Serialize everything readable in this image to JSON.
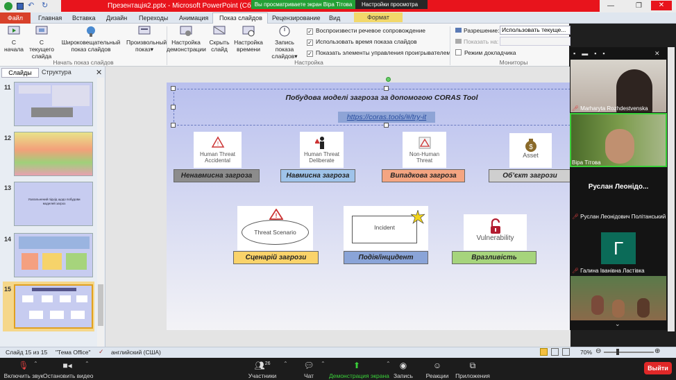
{
  "window": {
    "title": "Презентація2.pptx - Microsoft PowerPoint (Сбой акт",
    "share_banner": "Вы просматриваете экран Віра Тітова",
    "view_settings": "Настройки просмотра",
    "format_tab": "Формат"
  },
  "ribbon_tabs": [
    "Файл",
    "Главная",
    "Вставка",
    "Дизайн",
    "Переходы",
    "Анимация",
    "Показ слайдов",
    "Рецензирование",
    "Вид"
  ],
  "ribbon": {
    "groups": [
      "Начать показ слайдов",
      "Настройка",
      "Мониторы"
    ],
    "buttons": [
      {
        "label": "С начала",
        "icon": "slideshow-start-icon"
      },
      {
        "label": "С текущего слайда",
        "icon": "slideshow-current-icon"
      },
      {
        "label": "Широковещательный показ слайдов",
        "icon": "broadcast-icon"
      },
      {
        "label": "Произвольный показ",
        "icon": "custom-show-icon"
      },
      {
        "label": "Настройка демонстрации",
        "icon": "setup-show-icon"
      },
      {
        "label": "Скрыть слайд",
        "icon": "hide-slide-icon"
      },
      {
        "label": "Настройка времени",
        "icon": "rehearse-timings-icon"
      },
      {
        "label": "Запись показа слайдов",
        "icon": "record-show-icon"
      }
    ],
    "checkboxes": [
      {
        "label": "Воспроизвести речевое сопровождение",
        "checked": true
      },
      {
        "label": "Использовать время показа слайдов",
        "checked": true
      },
      {
        "label": "Показать элементы управления проигрывателем",
        "checked": true
      }
    ],
    "monitors": {
      "resolution_label": "Разрешение:",
      "resolution_value": "Использовать текуще...",
      "show_on_label": "Показать на:",
      "presenter_view": "Режим докладчика"
    }
  },
  "left_panel": {
    "tabs": [
      "Слайды",
      "Структура"
    ],
    "slides": [
      {
        "num": "11",
        "selected": false
      },
      {
        "num": "12",
        "selected": false
      },
      {
        "num": "13",
        "selected": false,
        "text": "Узагальнений підхід щодо побудови моделей загроз"
      },
      {
        "num": "14",
        "selected": false
      },
      {
        "num": "15",
        "selected": true
      }
    ]
  },
  "slide": {
    "title": "Побудова моделі загроза за допомогою CORAS Tool",
    "link": "https://coras.tools/#/try-it",
    "top_cards": [
      {
        "text": "Human Threat Accidental",
        "label": "Ненавмисна загроза",
        "label_color": "#8c8c8c"
      },
      {
        "text": "Human Threat Deliberate",
        "label": "Навмисна загроза",
        "label_color": "#9fc3ea"
      },
      {
        "text": "Non-Human Threat",
        "label": "Випадкова загроза",
        "label_color": "#f4a582"
      },
      {
        "text": "Asset",
        "label": "Об’єкт загрози",
        "label_color": "#cfcfcf"
      }
    ],
    "bottom_cards": [
      {
        "text": "Threat Scenario",
        "label": "Сценарій загрози",
        "label_color": "#fad36a"
      },
      {
        "text": "Incident",
        "label": "Подія/інцидент",
        "label_color": "#8aa4d8"
      },
      {
        "text": "Vulnerability",
        "label": "Вразливість",
        "label_color": "#a6d47c"
      }
    ]
  },
  "status_bar": {
    "slide_info": "Слайд 15 из 15",
    "theme": "\"Тема Office\"",
    "language": "английский (США)",
    "zoom": "70%"
  },
  "zoom_bar": {
    "mute": "Включить звук",
    "video": "Остановить видео",
    "participants": "Участники",
    "participants_count": "26",
    "chat": "Чат",
    "share": "Демонстрация экрана",
    "record": "Запись",
    "reactions": "Реакции",
    "apps": "Приложения",
    "leave": "Выйти"
  },
  "participants": [
    {
      "name": "Marharyta Rozhdestvenska",
      "muted": true
    },
    {
      "name": "Віра Тітова",
      "muted": false
    },
    {
      "name": "Руслан Леонідович Політанський",
      "display": "Руслан Леонідо...",
      "muted": true
    },
    {
      "name": "Галина Іванівна Ластівка",
      "initial": "Г",
      "muted": true
    }
  ],
  "colors": {
    "ribbon_red": "#e8141c",
    "file_tab": "#d8412a",
    "share_green": "#23a035",
    "leave_red": "#e02828",
    "avatar_green": "#0b6b58"
  }
}
